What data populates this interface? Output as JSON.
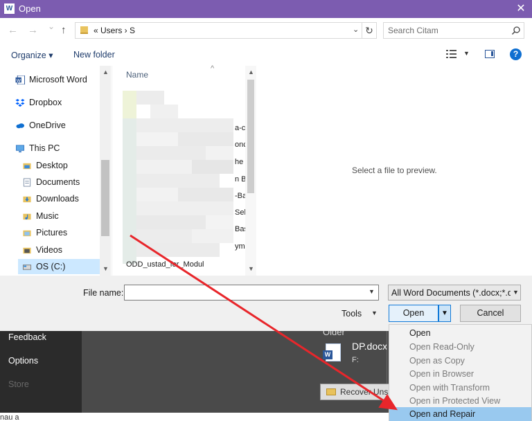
{
  "window": {
    "title": "Open",
    "app_icon": "word-icon",
    "close_glyph": "✕"
  },
  "nav": {
    "back_glyph": "←",
    "forward_glyph": "→",
    "recent_glyph": "⌄",
    "up_glyph": "↑",
    "address_text": "«  Users  ›  S",
    "address_chevron": "⌄",
    "refresh_glyph": "↻",
    "search_placeholder": "Search Citam"
  },
  "toolbar": {
    "organize_label": "Organize ▾",
    "new_folder_label": "New folder",
    "help_glyph": "?"
  },
  "tree": [
    {
      "label": "Microsoft Word",
      "icon": "word-icon"
    },
    {
      "label": "Dropbox",
      "icon": "dropbox-icon"
    },
    {
      "label": "OneDrive",
      "icon": "cloud-icon"
    },
    {
      "label": "This PC",
      "icon": "computer-icon"
    },
    {
      "label": "Desktop",
      "icon": "folder-icon"
    },
    {
      "label": "Documents",
      "icon": "documents-icon"
    },
    {
      "label": "Downloads",
      "icon": "downloads-icon"
    },
    {
      "label": "Music",
      "icon": "music-icon"
    },
    {
      "label": "Pictures",
      "icon": "pictures-icon"
    },
    {
      "label": "Videos",
      "icon": "videos-icon"
    },
    {
      "label": "OS (C:)",
      "icon": "drive-icon"
    }
  ],
  "filelist": {
    "column_name": "Name",
    "sort_glyph": "^",
    "fragments": [
      "a-c",
      "onc",
      "he",
      "n B",
      "-Ba",
      "Sel",
      "Bas",
      "ym"
    ],
    "partial_row": "ODD_ustad_for_Modul"
  },
  "preview": {
    "placeholder": "Select a file to preview."
  },
  "bottom": {
    "file_name_label": "File name:",
    "file_name_value": "",
    "filter_label": "All Word Documents (*.docx;*.d",
    "tools_label": "Tools",
    "open_label": "Open",
    "cancel_label": "Cancel",
    "caret_glyph": "▼"
  },
  "open_menu": {
    "items": [
      {
        "label": "Open",
        "enabled": true
      },
      {
        "label": "Open Read-Only",
        "enabled": false
      },
      {
        "label": "Open as Copy",
        "enabled": false
      },
      {
        "label": "Open in Browser",
        "enabled": false
      },
      {
        "label": "Open with Transform",
        "enabled": false
      },
      {
        "label": "Open in Protected View",
        "enabled": false
      },
      {
        "label": "Open and Repair",
        "enabled": true,
        "highlighted": true
      }
    ]
  },
  "backstage": {
    "sidebar": [
      "Feedback",
      "Options",
      "Store"
    ],
    "bottom_text": "nau a",
    "older_heading": "Older",
    "recent_doc_name": "DP.docx",
    "recent_doc_path": "F:",
    "recover_label": "Recover Unsaved"
  },
  "colors": {
    "titlebar": "#7c5cb0",
    "accent": "#0f78d7",
    "annotation_arrow": "#e8262b",
    "highlight": "#99c9ef"
  }
}
